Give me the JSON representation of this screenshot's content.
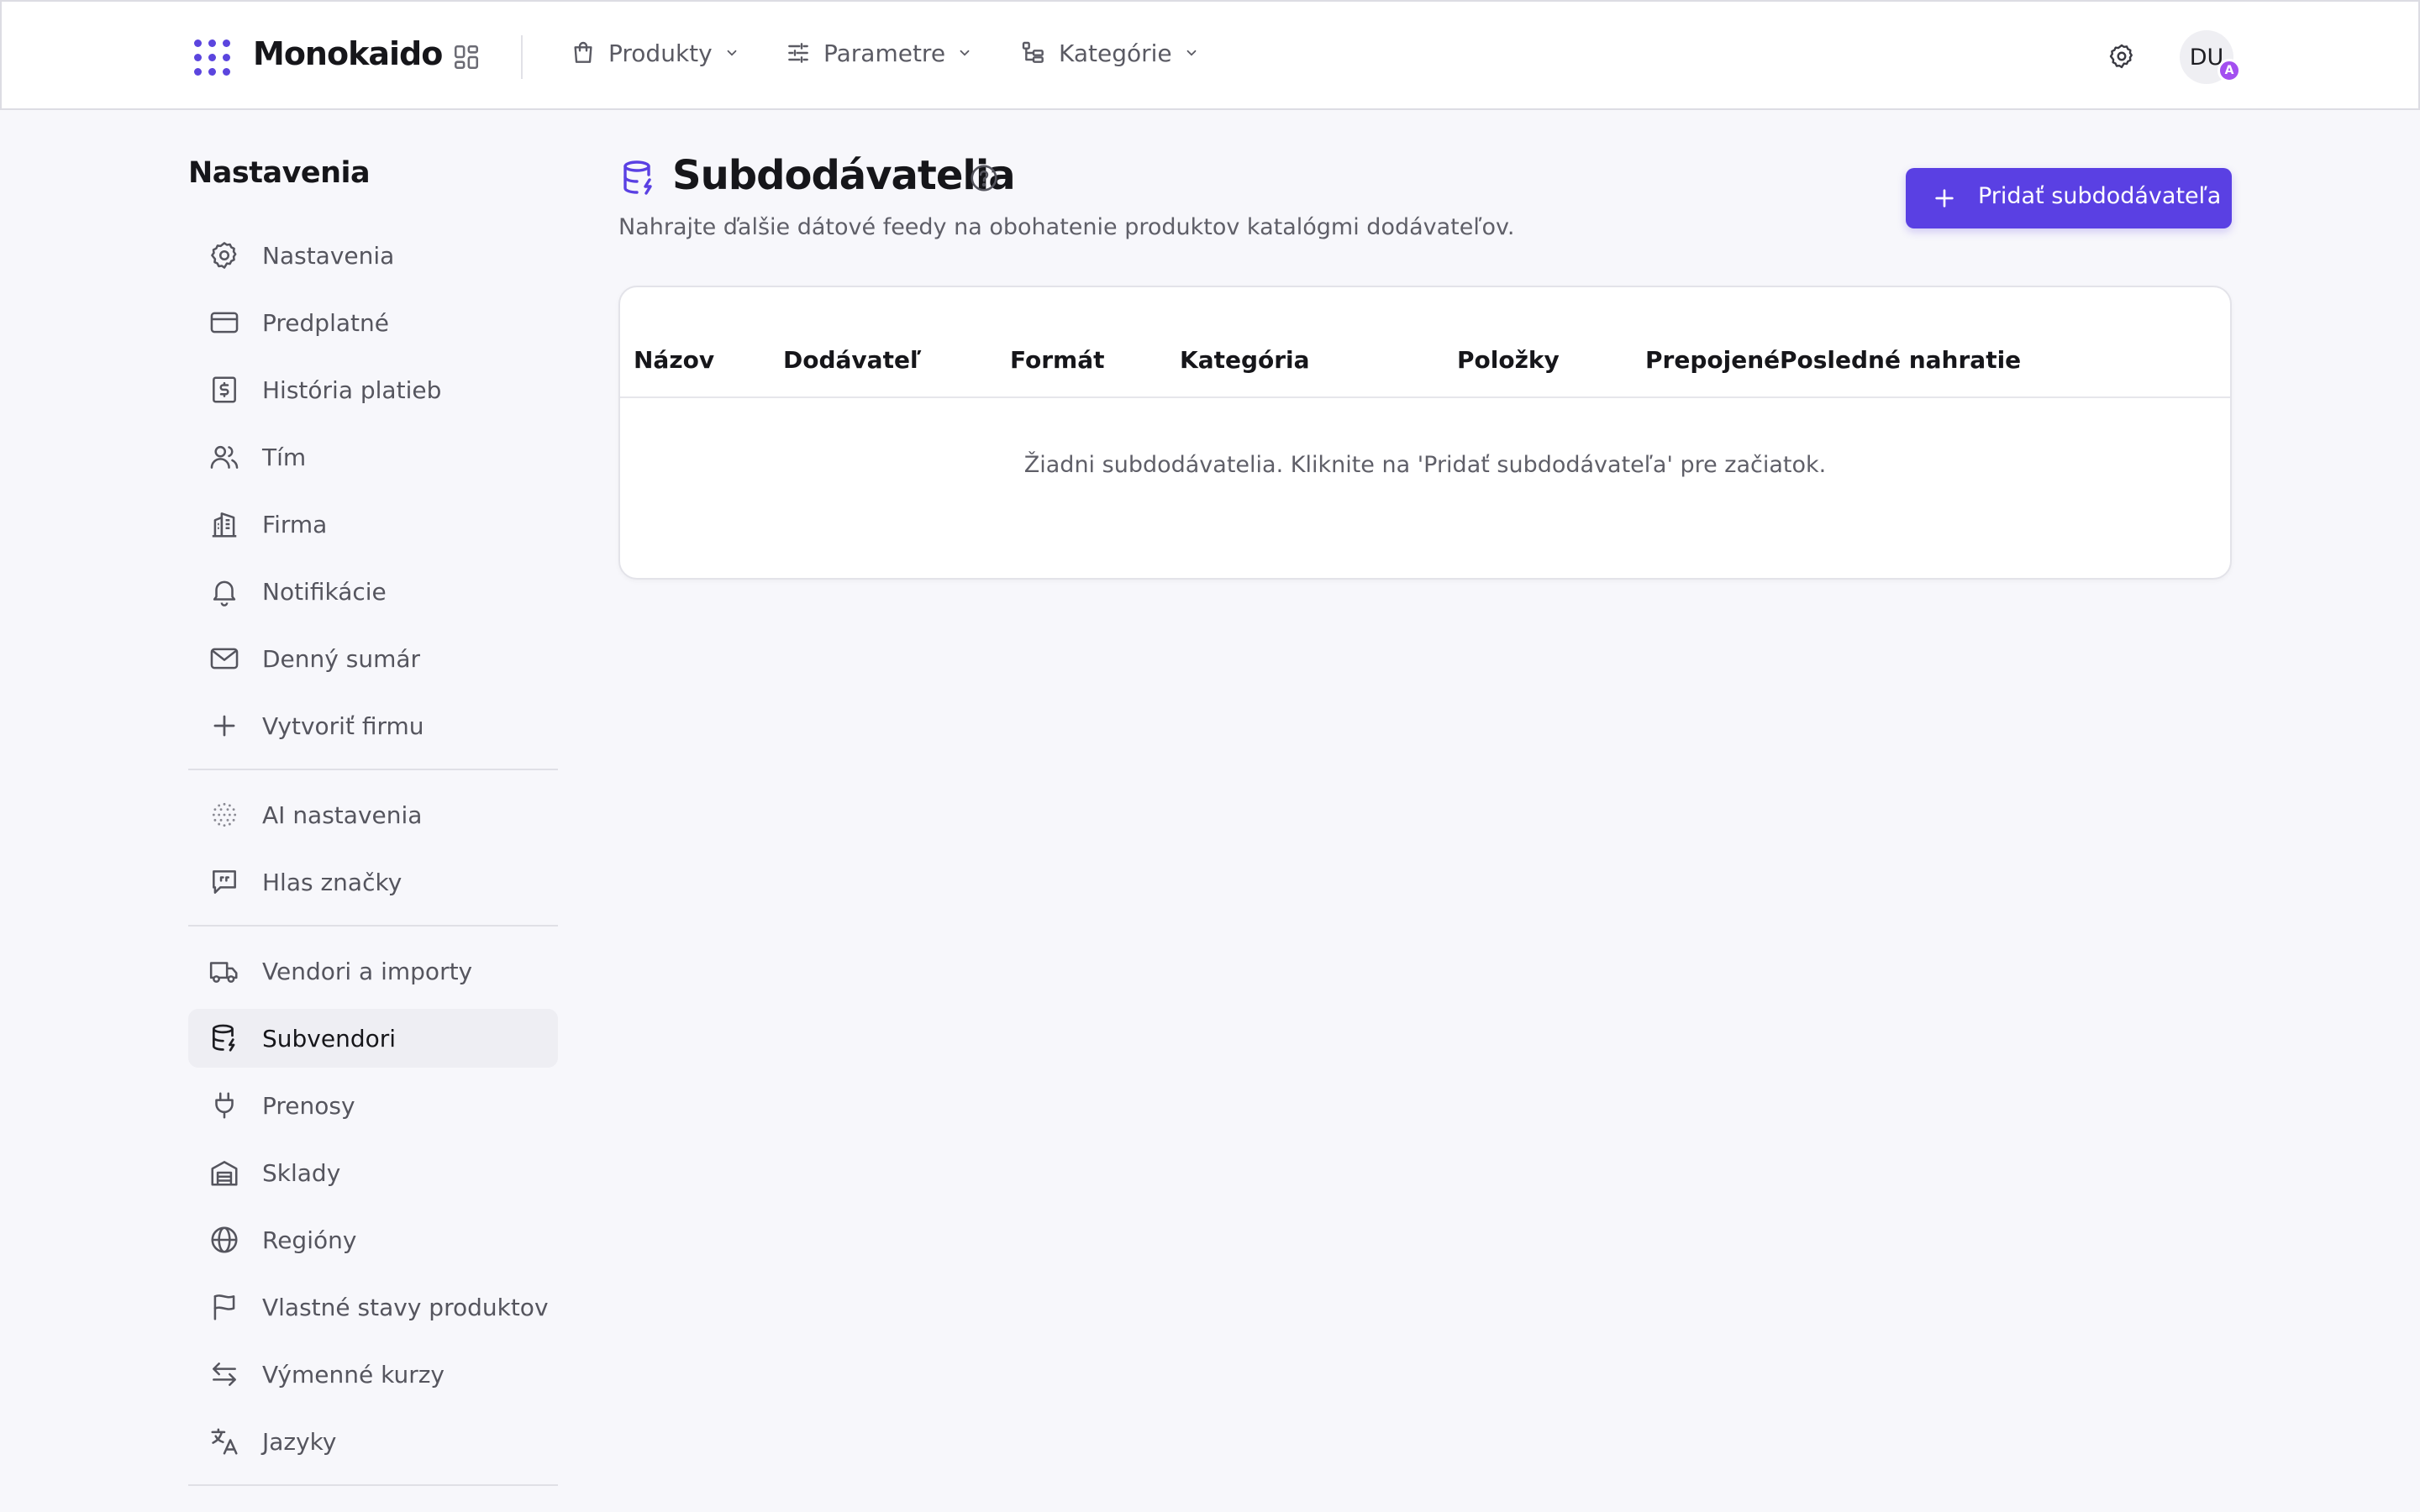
{
  "topbar": {
    "brand": "Monokaido",
    "nav": [
      {
        "label": "Produkty",
        "icon": "shopping-bag-icon"
      },
      {
        "label": "Parametre",
        "icon": "sliders-icon"
      },
      {
        "label": "Kategórie",
        "icon": "category-tree-icon"
      }
    ],
    "avatar_initials": "DU",
    "avatar_badge": "A"
  },
  "sidebar": {
    "title": "Nastavenia",
    "groups": [
      [
        {
          "label": "Nastavenia",
          "icon": "gear-icon"
        },
        {
          "label": "Predplatné",
          "icon": "credit-card-icon"
        },
        {
          "label": "História platieb",
          "icon": "receipt-dollar-icon"
        },
        {
          "label": "Tím",
          "icon": "users-icon"
        },
        {
          "label": "Firma",
          "icon": "building-icon"
        },
        {
          "label": "Notifikácie",
          "icon": "bell-icon"
        },
        {
          "label": "Denný sumár",
          "icon": "mail-icon"
        },
        {
          "label": "Vytvoriť firmu",
          "icon": "plus-icon"
        }
      ],
      [
        {
          "label": "AI nastavenia",
          "icon": "ai-sphere-icon"
        },
        {
          "label": "Hlas značky",
          "icon": "quote-message-icon"
        }
      ],
      [
        {
          "label": "Vendori a importy",
          "icon": "truck-icon"
        },
        {
          "label": "Subvendori",
          "icon": "database-bolt-icon",
          "active": true
        },
        {
          "label": "Prenosy",
          "icon": "plug-icon"
        },
        {
          "label": "Sklady",
          "icon": "warehouse-icon"
        },
        {
          "label": "Regióny",
          "icon": "globe-icon"
        },
        {
          "label": "Vlastné stavy produktov",
          "icon": "flag-icon"
        },
        {
          "label": "Výmenné kurzy",
          "icon": "exchange-arrows-icon"
        },
        {
          "label": "Jazyky",
          "icon": "translate-icon"
        }
      ]
    ]
  },
  "main": {
    "title": "Subdodávatelia",
    "subtitle": "Nahrajte ďalšie dátové feedy na obohatenie produktov katalógmi dodávateľov.",
    "add_button": "Pridať subdodávateľa",
    "table": {
      "columns": [
        "Názov",
        "Dodávateľ",
        "Formát",
        "Kategória",
        "Položky",
        "Prepojené",
        "Posledné nahratie"
      ],
      "empty_message": "Žiadni subdodávatelia. Kliknite na 'Pridať subdodávateľa' pre začiatok."
    }
  },
  "colors": {
    "accent": "#5a40e3",
    "badge": "#a34ff0",
    "background": "#f7f7fb"
  }
}
